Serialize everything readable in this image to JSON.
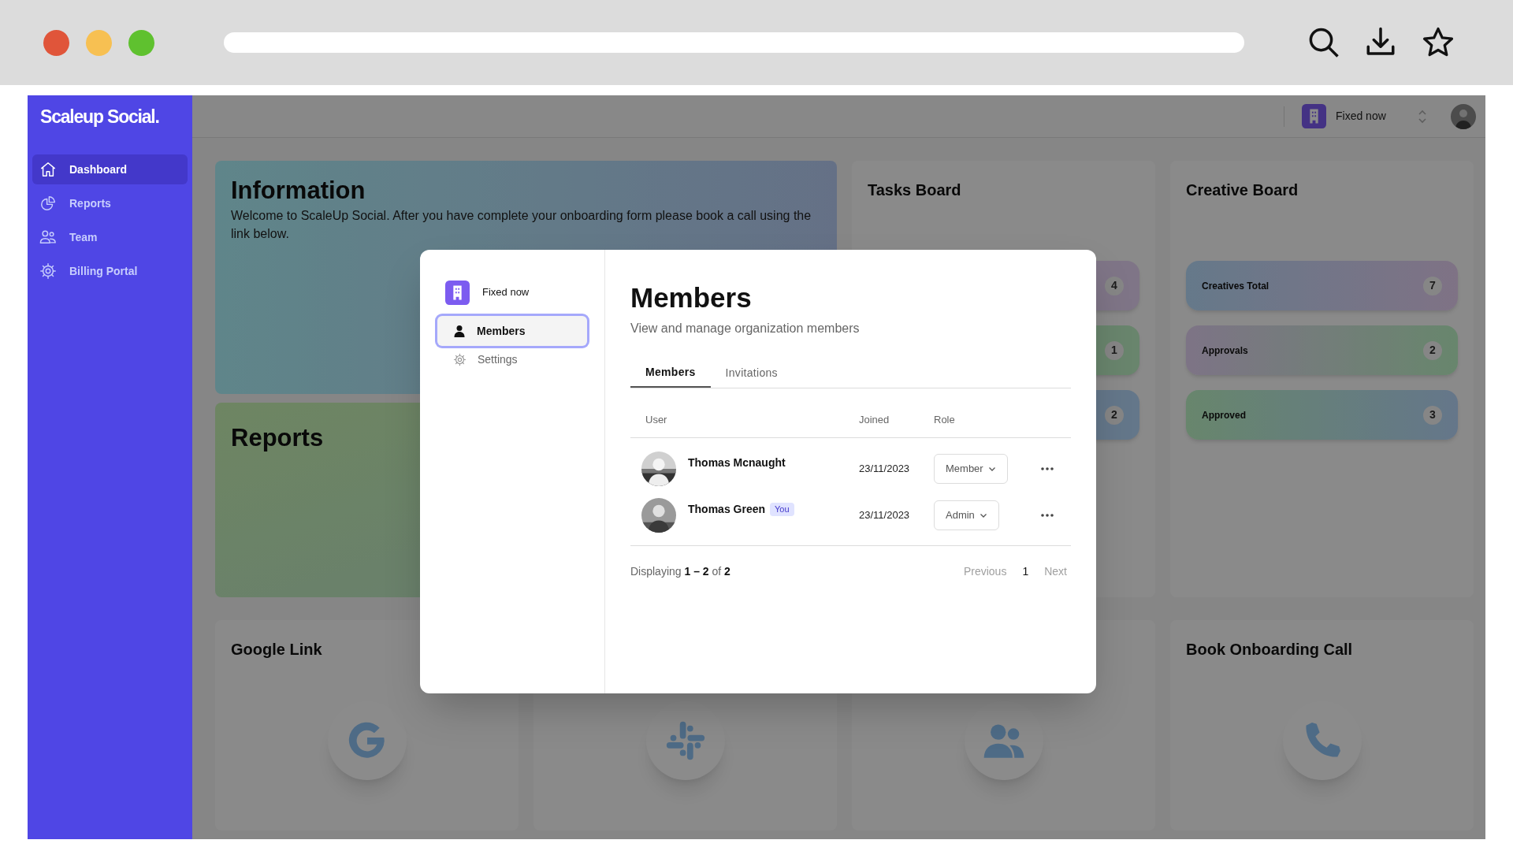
{
  "sidebar": {
    "logo": "Scaleup Social.",
    "items": [
      {
        "label": "Dashboard",
        "kind": "home",
        "selected": true
      },
      {
        "label": "Reports",
        "kind": "pie",
        "selected": false
      },
      {
        "label": "Team",
        "kind": "users",
        "selected": false
      },
      {
        "label": "Billing Portal",
        "kind": "gear",
        "selected": false
      }
    ]
  },
  "topbar": {
    "organization": "Fixed now"
  },
  "information": {
    "title": "Information",
    "text": "Welcome to ScaleUp Social. After you have complete your onboarding form please book a call using the link below."
  },
  "reports": {
    "title": "Reports"
  },
  "tasks_board": {
    "title": "Tasks Board",
    "items": [
      {
        "count": "4"
      },
      {
        "count": "1"
      },
      {
        "count": "2"
      }
    ]
  },
  "creative_board": {
    "title": "Creative Board",
    "items": [
      {
        "label": "Creatives Total",
        "count": "7"
      },
      {
        "label": "Approvals",
        "count": "2"
      },
      {
        "label": "Approved",
        "count": "3"
      }
    ]
  },
  "links": [
    {
      "title": "Google Link",
      "kind": "google"
    },
    {
      "kind": "slack"
    },
    {
      "kind": "people"
    },
    {
      "title": "Book Onboarding Call",
      "kind": "phone"
    }
  ],
  "modal": {
    "organization": "Fixed now",
    "nav": [
      {
        "label": "Members",
        "kind": "person",
        "selected": true
      },
      {
        "label": "Settings",
        "kind": "gear",
        "selected": false
      }
    ],
    "title": "Members",
    "subtitle": "View and manage organization members",
    "tabs": [
      {
        "label": "Members",
        "selected": true
      },
      {
        "label": "Invitations",
        "selected": false
      }
    ],
    "table": {
      "columns": [
        "User",
        "Joined",
        "Role"
      ],
      "rows": [
        {
          "name": "Thomas Mcnaught",
          "joined": "23/11/2023",
          "role": "Member"
        },
        {
          "name": "Thomas Green",
          "badge": "You",
          "joined": "23/11/2023",
          "role": "Admin"
        }
      ]
    },
    "footer": "Displaying **1 – 2** of **2**",
    "pagination": [
      {
        "label": "Previous",
        "kind": "prev",
        "disabled": true
      },
      {
        "label": "1",
        "kind": "page",
        "selected": true
      },
      {
        "label": "Next",
        "kind": "next",
        "disabled": true
      }
    ]
  }
}
